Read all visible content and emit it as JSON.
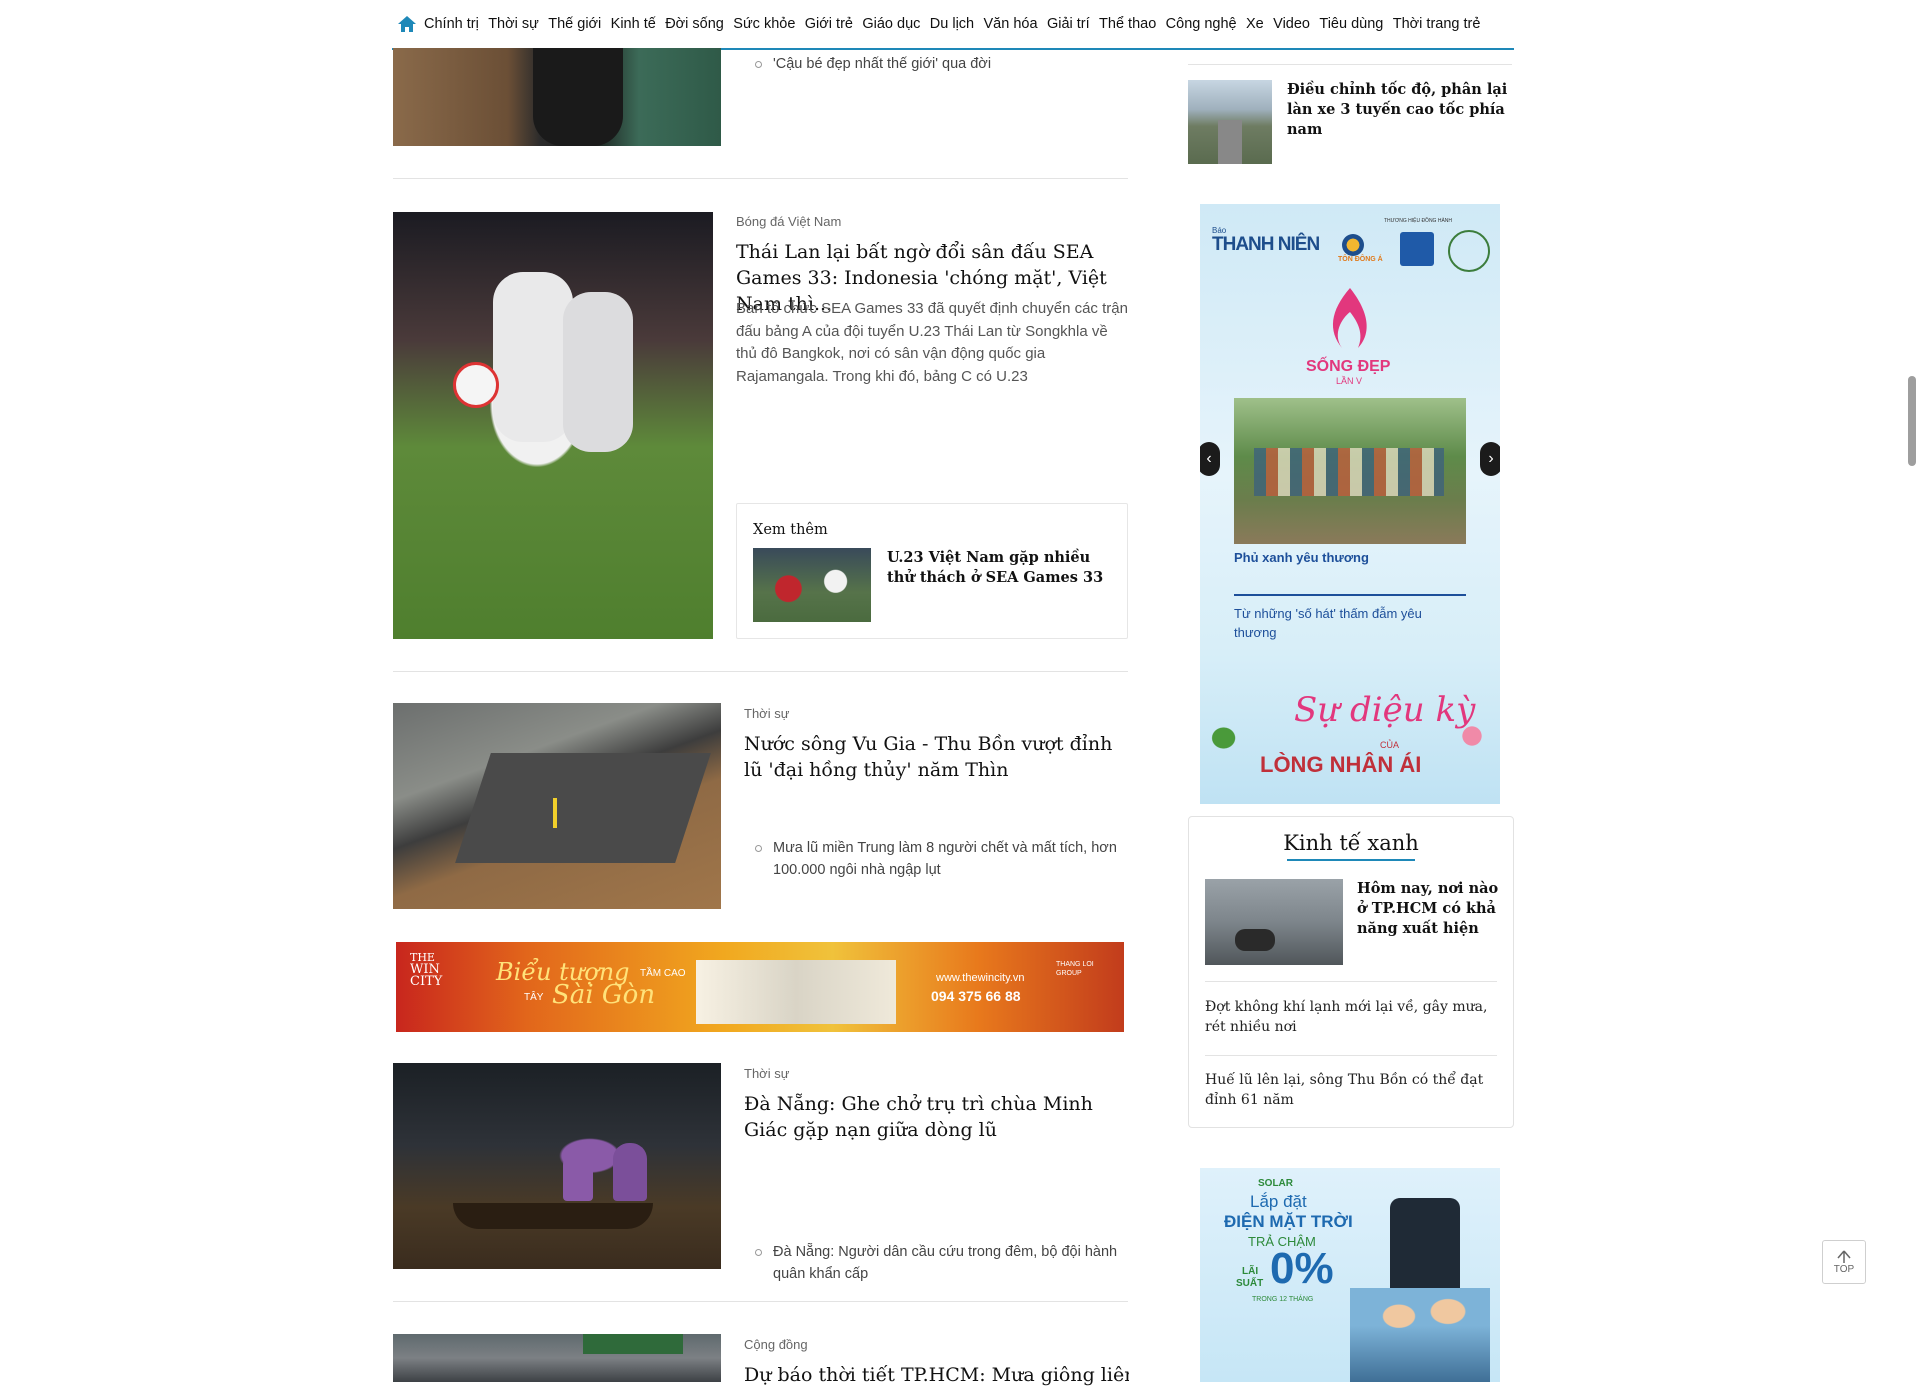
{
  "nav": {
    "items": [
      "Chính trị",
      "Thời sự",
      "Thế giới",
      "Kinh tế",
      "Đời sống",
      "Sức khỏe",
      "Giới trẻ",
      "Giáo dục",
      "Du lịch",
      "Văn hóa",
      "Giải trí",
      "Thể thao",
      "Công nghệ",
      "Xe",
      "Video",
      "Tiêu dùng",
      "Thời trang trẻ"
    ],
    "accent": "#1e88b8"
  },
  "articles": {
    "a0": {
      "related": "'Cậu bé đẹp nhất thế giới' qua đời"
    },
    "a1": {
      "category": "Bóng đá Việt Nam",
      "title": "Thái Lan lại bất ngờ đổi sân đấu SEA Games 33: Indonesia 'chóng mặt', Việt Nam thì...",
      "sapo": "Ban tổ chức SEA Games 33 đã quyết định chuyển các trận đấu bảng A của đội tuyển U.23 Thái Lan từ Songkhla về thủ đô Bangkok, nơi có sân vận động quốc gia Rajamangala. Trong khi đó, bảng C có U.23",
      "xemthem_label": "Xem thêm",
      "xemthem_title": "U.23 Việt Nam gặp nhiều thử thách ở SEA Games 33"
    },
    "a2": {
      "category": "Thời sự",
      "title": "Nước sông Vu Gia - Thu Bồn vượt đỉnh lũ 'đại hồng thủy' năm Thìn",
      "related": "Mưa lũ miền Trung làm 8 người chết và mất tích, hơn 100.000 ngôi nhà ngập lụt"
    },
    "a3": {
      "category": "Thời sự",
      "title": "Đà Nẵng: Ghe chở trụ trì chùa Minh Giác gặp nạn giữa dòng lũ",
      "related": "Đà Nẵng: Người dân cầu cứu trong đêm, bộ đội hành quân khẩn cấp"
    },
    "a4": {
      "category": "Cộng đồng",
      "title": "Dự báo thời tiết TP.HCM: Mưa giông liên tục"
    }
  },
  "sidebar": {
    "top_item": "Điều chỉnh tốc độ, phân lại làn xe 3 tuyến cao tốc phía nam",
    "ad1": {
      "brand": "THANH NIÊN",
      "brand_small": "Báo",
      "sponsor_label": "THƯƠNG HIỆU ĐỒNG HÀNH",
      "sponsor_1": "TÔN ĐÔNG Á",
      "campaign": "SỐNG ĐẸP",
      "campaign_sub": "LẦN V",
      "item1": "Phủ xanh yêu thương",
      "item2": "Từ những 'số hát' thấm đẫm yêu thương",
      "slogan_1": "Sự diệu kỳ",
      "slogan_2": "CỦA",
      "slogan_3": "LÒNG NHÂN ÁI"
    },
    "ktx": {
      "title": "Kinh tế xanh",
      "item1": "Hôm nay, nơi nào ở TP.HCM có khả năng xuất hiện",
      "item2": "Đợt không khí lạnh mới lại về, gây mưa, rét nhiều nơi",
      "item3": "Huế lũ lên lại, sông Thu Bồn có thể đạt đỉnh 61 năm"
    },
    "ad2": {
      "brand": "SOLAR",
      "line1": "Lắp đặt",
      "line2": "ĐIỆN MẶT TRỜI",
      "line3": "TRẢ CHẬM",
      "rate_label_1": "LÃI",
      "rate_label_2": "SUẤT",
      "rate": "0%",
      "rate_sub": "TRONG 12 THÁNG"
    }
  },
  "ads": {
    "wincity": {
      "brand_1": "THE",
      "brand_2": "WIN",
      "brand_3": "CITY",
      "headline_1": "Biểu tượng",
      "headline_2": "TẦM CAO",
      "headline_3": "TÂY",
      "headline_4": "Sài Gòn",
      "url": "www.thewincity.vn",
      "phone": "094 375 66 88",
      "group": "THANG LOI GROUP"
    }
  },
  "top_button": "TOP"
}
